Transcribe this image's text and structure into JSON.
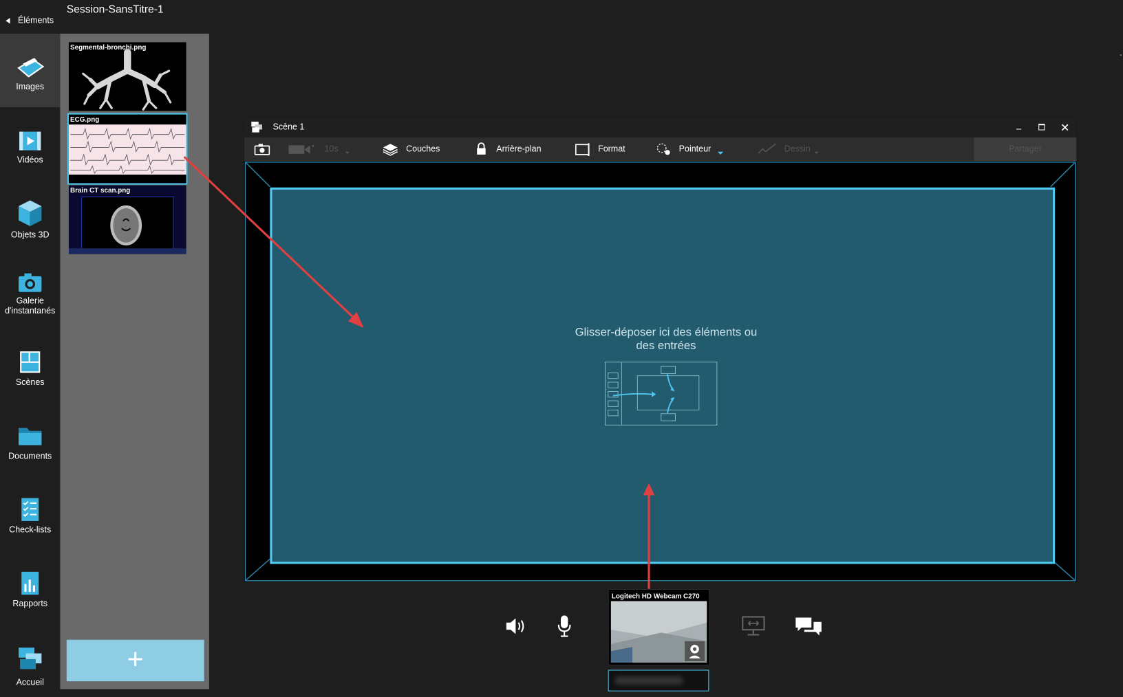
{
  "header": {
    "back_label": "Éléments",
    "session_title": "Session-SansTitre-1"
  },
  "sidebar": {
    "items": [
      {
        "id": "images",
        "label": "Images",
        "icon": "images-icon",
        "active": true
      },
      {
        "id": "videos",
        "label": "Vidéos",
        "icon": "video-icon",
        "active": false
      },
      {
        "id": "objets3d",
        "label": "Objets 3D",
        "icon": "cube-icon",
        "active": false
      },
      {
        "id": "galerie",
        "label_line1": "Galerie",
        "label_line2": "d'instantanés",
        "icon": "camera-icon",
        "active": false
      },
      {
        "id": "scenes",
        "label": "Scènes",
        "icon": "scenes-icon",
        "active": false
      },
      {
        "id": "documents",
        "label": "Documents",
        "icon": "folder-icon",
        "active": false
      },
      {
        "id": "checklists",
        "label": "Check-lists",
        "icon": "checklist-icon",
        "active": false
      },
      {
        "id": "rapports",
        "label": "Rapports",
        "icon": "report-icon",
        "active": false
      },
      {
        "id": "accueil",
        "label": "Accueil",
        "icon": "home-icon",
        "active": false
      }
    ]
  },
  "panel": {
    "thumbnails": [
      {
        "name": "Segmental-bronchi.png",
        "selected": false,
        "icon": "bronchi-image"
      },
      {
        "name": "ECG.png",
        "selected": true,
        "icon": "ecg-image"
      },
      {
        "name": "Brain CT scan.png",
        "selected": false,
        "icon": "brain-ct-image"
      }
    ],
    "add_label": "+"
  },
  "scene": {
    "title": "Scène 1",
    "toolbar": {
      "video_duration": "10s",
      "couches": "Couches",
      "arriere_plan": "Arrière-plan",
      "format": "Format",
      "pointeur": "Pointeur",
      "dessin": "Dessin",
      "partager": "Partager"
    },
    "drop_text_line1": "Glisser-déposer ici des éléments ou",
    "drop_text_line2": "des entrées"
  },
  "bottom": {
    "webcam_label": "Logitech HD Webcam C270"
  },
  "colors": {
    "accent": "#4fc8f0",
    "drop_bg": "#225a6e",
    "add_button": "#8fcde5",
    "arrow": "#e04040"
  }
}
